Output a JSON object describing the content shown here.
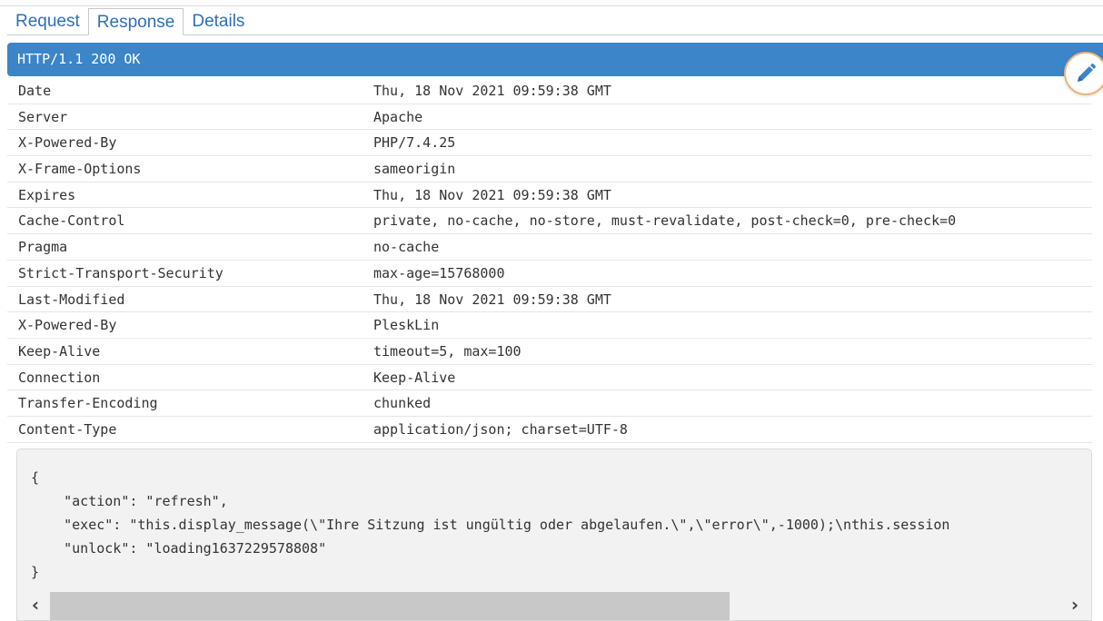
{
  "tabs": [
    {
      "label": "Request"
    },
    {
      "label": "Response"
    },
    {
      "label": "Details"
    }
  ],
  "active_tab": "Response",
  "status_line": "HTTP/1.1 200 OK",
  "headers": [
    {
      "name": "Date",
      "value": "Thu, 18 Nov 2021 09:59:38 GMT"
    },
    {
      "name": "Server",
      "value": "Apache"
    },
    {
      "name": "X-Powered-By",
      "value": "PHP/7.4.25"
    },
    {
      "name": "X-Frame-Options",
      "value": "sameorigin"
    },
    {
      "name": "Expires",
      "value": "Thu, 18 Nov 2021 09:59:38 GMT"
    },
    {
      "name": "Cache-Control",
      "value": "private, no-cache, no-store, must-revalidate, post-check=0, pre-check=0"
    },
    {
      "name": "Pragma",
      "value": "no-cache"
    },
    {
      "name": "Strict-Transport-Security",
      "value": "max-age=15768000"
    },
    {
      "name": "Last-Modified",
      "value": "Thu, 18 Nov 2021 09:59:38 GMT"
    },
    {
      "name": "X-Powered-By",
      "value": "PleskLin"
    },
    {
      "name": "Keep-Alive",
      "value": "timeout=5, max=100"
    },
    {
      "name": "Connection",
      "value": "Keep-Alive"
    },
    {
      "name": "Transfer-Encoding",
      "value": "chunked"
    },
    {
      "name": "Content-Type",
      "value": "application/json; charset=UTF-8"
    }
  ],
  "response_body": "{\n    \"action\": \"refresh\",\n    \"exec\": \"this.display_message(\\\"Ihre Sitzung ist ungültig oder abgelaufen.\\\",\\\"error\\\",-1000);\\nthis.session\n    \"unlock\": \"loading1637229578808\"\n}",
  "scrollbar": {
    "left_arrow": "‹",
    "right_arrow": "›"
  },
  "icons": {
    "edit": "pencil-icon"
  },
  "colors": {
    "status_bar": "#3b85c8",
    "tab_text": "#2f6fb7",
    "edit_ring": "#f0b47a"
  }
}
